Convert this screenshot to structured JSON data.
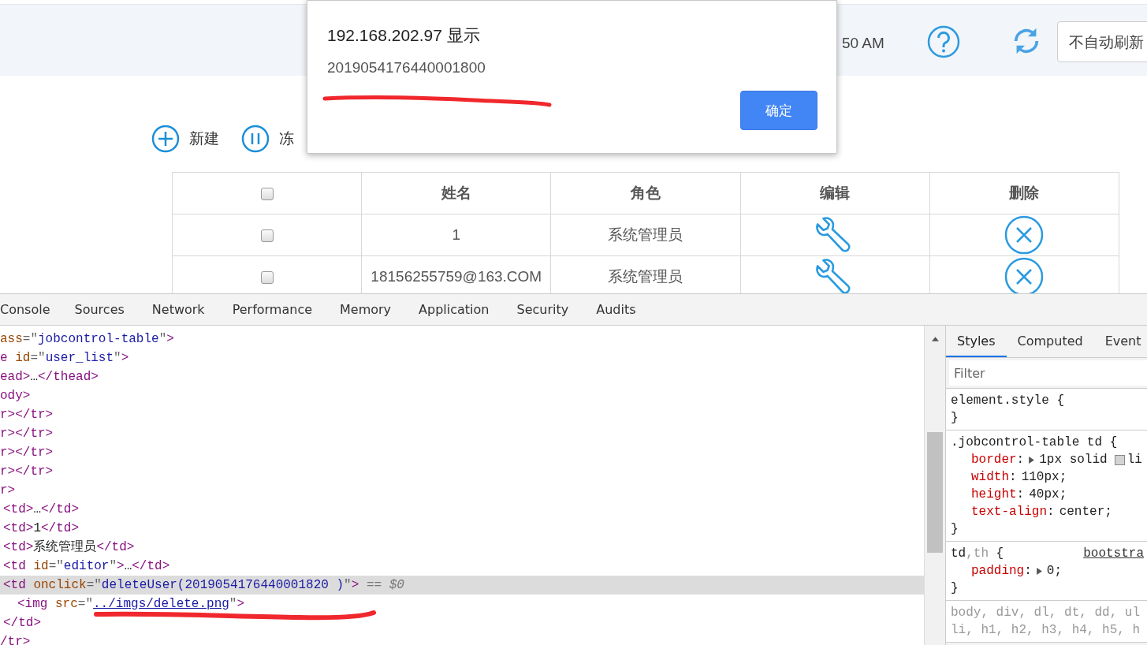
{
  "top_bar": {
    "time": "50 AM",
    "refresh_select": {
      "value": "不自动刷新"
    }
  },
  "toolbar": [
    {
      "kind": "add",
      "label": "新建"
    },
    {
      "kind": "pause",
      "label": "冻"
    }
  ],
  "table": {
    "columns": [
      {
        "kind": "checkbox",
        "checked": false
      },
      {
        "kind": "text",
        "label": "姓名"
      },
      {
        "kind": "text",
        "label": "角色"
      },
      {
        "kind": "text",
        "label": "编辑"
      },
      {
        "kind": "text",
        "label": "删除"
      }
    ],
    "rows": [
      {
        "checked": false,
        "name": "1",
        "role": "系统管理员"
      },
      {
        "checked": false,
        "name": "18156255759@163.COM",
        "role": "系统管理员"
      }
    ]
  },
  "dialog": {
    "title": "192.168.202.97 显示",
    "message": "2019054176440001800",
    "button": "确定"
  },
  "devtools": {
    "tabs": [
      {
        "label": "Console",
        "selected": false
      },
      {
        "label": "Sources",
        "selected": false
      },
      {
        "label": "Network",
        "selected": false
      },
      {
        "label": "Performance",
        "selected": false
      },
      {
        "label": "Memory",
        "selected": false
      },
      {
        "label": "Application",
        "selected": false
      },
      {
        "label": "Security",
        "selected": false
      },
      {
        "label": "Audits",
        "selected": false
      }
    ],
    "dom_tree": [
      {
        "selected": false,
        "tokens": [
          {
            "kind": "attr",
            "text": "ass"
          },
          {
            "kind": "eq",
            "text": "=\""
          },
          {
            "kind": "value",
            "text": "jobcontrol-table"
          },
          {
            "kind": "eq",
            "text": "\""
          },
          {
            "kind": "tag",
            "text": ">"
          }
        ]
      },
      {
        "selected": false,
        "tokens": [
          {
            "kind": "tag",
            "text": "e"
          },
          {
            "kind": "attr",
            "text": " id"
          },
          {
            "kind": "eq",
            "text": "=\""
          },
          {
            "kind": "value",
            "text": "user_list"
          },
          {
            "kind": "eq",
            "text": "\""
          },
          {
            "kind": "tag",
            "text": ">"
          }
        ]
      },
      {
        "selected": false,
        "tokens": [
          {
            "kind": "tag",
            "text": "ead>"
          },
          {
            "kind": "text",
            "text": "…"
          },
          {
            "kind": "tag",
            "text": "</thead>"
          }
        ]
      },
      {
        "selected": false,
        "tokens": [
          {
            "kind": "tag",
            "text": "ody>"
          }
        ]
      },
      {
        "selected": false,
        "tokens": [
          {
            "kind": "tag",
            "text": "r></tr>"
          }
        ]
      },
      {
        "selected": false,
        "tokens": [
          {
            "kind": "tag",
            "text": "r></tr>"
          }
        ]
      },
      {
        "selected": false,
        "tokens": [
          {
            "kind": "tag",
            "text": "r></tr>"
          }
        ]
      },
      {
        "selected": false,
        "tokens": [
          {
            "kind": "tag",
            "text": "r></tr>"
          }
        ]
      },
      {
        "selected": false,
        "tokens": [
          {
            "kind": "tag",
            "text": "r>"
          }
        ],
        "children": [
          {
            "selected": false,
            "tokens": [
              {
                "kind": "tag",
                "text": "<td>"
              },
              {
                "kind": "text",
                "text": "…"
              },
              {
                "kind": "tag",
                "text": "</td>"
              }
            ]
          },
          {
            "selected": false,
            "tokens": [
              {
                "kind": "tag",
                "text": "<td>"
              },
              {
                "kind": "text",
                "text": "1"
              },
              {
                "kind": "tag",
                "text": "</td>"
              }
            ]
          },
          {
            "selected": false,
            "tokens": [
              {
                "kind": "tag",
                "text": "<td>"
              },
              {
                "kind": "text",
                "text": "系统管理员"
              },
              {
                "kind": "tag",
                "text": "</td>"
              }
            ]
          },
          {
            "selected": false,
            "tokens": [
              {
                "kind": "tag",
                "text": "<td"
              },
              {
                "kind": "attr",
                "text": " id"
              },
              {
                "kind": "eq",
                "text": "=\""
              },
              {
                "kind": "value",
                "text": "editor"
              },
              {
                "kind": "eq",
                "text": "\""
              },
              {
                "kind": "tag",
                "text": ">"
              },
              {
                "kind": "text",
                "text": "…"
              },
              {
                "kind": "tag",
                "text": "</td>"
              }
            ]
          },
          {
            "selected": true,
            "tokens": [
              {
                "kind": "tag",
                "text": "<td"
              },
              {
                "kind": "attr",
                "text": " onclick"
              },
              {
                "kind": "eq",
                "text": "=\""
              },
              {
                "kind": "value",
                "text": "deleteUser(2019054176440001820 )"
              },
              {
                "kind": "eq",
                "text": "\""
              },
              {
                "kind": "tag",
                "text": ">"
              },
              {
                "kind": "hint",
                "text": " == $0"
              }
            ],
            "children": [
              {
                "selected": false,
                "tokens": [
                  {
                    "kind": "tag",
                    "text": "<img"
                  },
                  {
                    "kind": "attr",
                    "text": " src"
                  },
                  {
                    "kind": "eq",
                    "text": "=\""
                  },
                  {
                    "kind": "link",
                    "text": "../imgs/delete.png"
                  },
                  {
                    "kind": "eq",
                    "text": "\""
                  },
                  {
                    "kind": "tag",
                    "text": ">"
                  }
                ]
              }
            ]
          },
          {
            "selected": false,
            "tokens": [
              {
                "kind": "tag",
                "text": "</td>"
              }
            ]
          }
        ]
      },
      {
        "selected": false,
        "tokens": [
          {
            "kind": "tag",
            "text": "/tr>"
          }
        ]
      }
    ],
    "side_tabs": [
      {
        "label": "Styles",
        "selected": true
      },
      {
        "label": "Computed",
        "selected": false
      },
      {
        "label": "Event",
        "selected": false
      }
    ],
    "filter": {
      "placeholder": "Filter"
    },
    "rules": [
      {
        "selectors": [
          {
            "text": "element.style",
            "matched": true
          }
        ],
        "open": "{",
        "close": "}"
      },
      {
        "selectors": [
          {
            "text": ".jobcontrol-table td",
            "matched": true
          }
        ],
        "open": "{",
        "declarations": [
          {
            "property": "border",
            "sep": ":",
            "expandable": true,
            "value": "1px solid",
            "swatch": true,
            "tail": "li"
          },
          {
            "property": "width",
            "sep": ":",
            "expandable": false,
            "value": "110px;",
            "swatch": false
          },
          {
            "property": "height",
            "sep": ":",
            "expandable": false,
            "value": "40px;",
            "swatch": false
          },
          {
            "property": "text-align",
            "sep": ":",
            "expandable": false,
            "value": "center;",
            "swatch": false
          }
        ],
        "close": "}"
      },
      {
        "selectors": [
          {
            "text": "td",
            "matched": true
          },
          {
            "text": "th",
            "matched": false
          }
        ],
        "separator": ",",
        "open": "{",
        "source": "bootstra",
        "declarations": [
          {
            "property": "padding",
            "sep": ":",
            "expandable": true,
            "value": "0;",
            "swatch": false
          }
        ],
        "close": "}"
      },
      {
        "selector_lines": [
          "body, div, dl, dt, dd, ul",
          "li, h1, h2, h3, h4, h5, h"
        ]
      }
    ]
  }
}
